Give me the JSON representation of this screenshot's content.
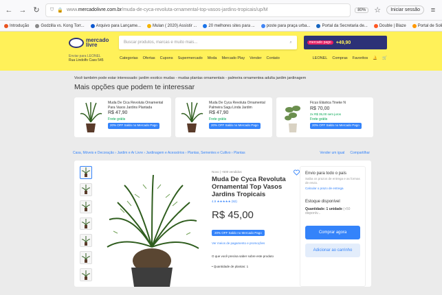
{
  "browser": {
    "url_prefix": "www.",
    "url_domain": "mercadolivre.com.br",
    "url_path": "/muda-de-cyca-revoluta-ornamental-top-vasos-jardins-tropicais/up/M",
    "zoom": "80%",
    "signin": "Iniciar sessão"
  },
  "bookmarks": [
    {
      "label": "Introdução",
      "color": "#e95420"
    },
    {
      "label": "Godzilla vs. Kong Torr...",
      "color": "#888888"
    },
    {
      "label": "Arquivo para Lançame...",
      "color": "#0b57d0"
    },
    {
      "label": "Mulan ( 2020) Assistir ...",
      "color": "#f4b400"
    },
    {
      "label": "20 melhores sites para ...",
      "color": "#1a73e8"
    },
    {
      "label": "poste para praça urba...",
      "color": "#4285f4"
    },
    {
      "label": "Portal da Secretaria de...",
      "color": "#1565c0"
    },
    {
      "label": "Double | Blaze",
      "color": "#ff5722"
    },
    {
      "label": "Portal de Solicitações",
      "color": "#ff9800"
    }
  ],
  "header": {
    "logo_line1": "mercado",
    "logo_line2": "livre",
    "search_placeholder": "Buscar produtos, marcas e muito mais...",
    "promo_tag": "mercado pago",
    "promo_price": "+49,90",
    "location_line1": "Enviar para LEONEL",
    "location_line2": "Rua Lindolfo Cass 545",
    "categories": [
      "Categorias",
      "Ofertas",
      "Cupons",
      "Supermercado",
      "Moda",
      "Mercado Play",
      "Vender",
      "Contato"
    ],
    "user": "LEONEL",
    "purchases": "Compras",
    "favorites": "Favoritos"
  },
  "related_line": "Você também pode estar interessado: jardim exotico mudas - mudas plantas ornamentais - palmeira ornamentea adulta jardim jardinagem",
  "section_title": "Mais opções que podem te interessar",
  "cards": [
    {
      "title": "Muda De Cica Revoluta Ornamental Para Vasos Jardins Plantada",
      "price": "R$ 47,90",
      "inst": "",
      "ship": "Frete grátis",
      "badge": "20% OFF Saldo no Mercado Pago"
    },
    {
      "title": "Muda De Cyca Revoluta Ornamental Palmeira Sagu Linda Jardim",
      "price": "R$ 47,90",
      "inst": "",
      "ship": "Frete grátis",
      "badge": "20% OFF Saldo no Mercado Pago"
    },
    {
      "title": "Ficus Elástica Tineke N",
      "price": "R$ 70,00",
      "inst": "2x R$ 35,00 sem juros",
      "ship": "Frete grátis",
      "badge": "20% OFF Saldo no Mercado Pago"
    }
  ],
  "breadcrumb": "Casa, Móveis e Decoração  ›  Jardim e Ar Livre  ›  Jardinagem e Acessórios  ›  Plantas, Sementes e Cultivo  ›  Plantas",
  "crumb_links": [
    "Vender um igual",
    "Compartilhar"
  ],
  "product": {
    "condition": "Novo  |  +500 vendidos",
    "title": "Muda De Cyca Revoluta Ornamental Top Vasos Jardins Tropicais",
    "rating": "4.9 ★★★★★ (92)",
    "price": "R$ 45,00",
    "badge": "20% OFF Saldo no Mercado Pago",
    "payment_link": "Ver meios de pagamento e promoções",
    "need_text": "O que você precisa saber sobre este produto",
    "qty_line": "• Quantidade de plantas: 1"
  },
  "buybox": {
    "title": "Envio para todo o país",
    "subtitle": "Saiba os prazos de entrega e as formas de envio.",
    "calc_link": "Calcular o prazo de entrega",
    "stock": "Estoque disponível",
    "qty_label": "Quantidade: 1 unidade",
    "qty_avail": "(+50 disponív...",
    "buy": "Comprar agora",
    "cart": "Adicionar ao carrinho"
  }
}
